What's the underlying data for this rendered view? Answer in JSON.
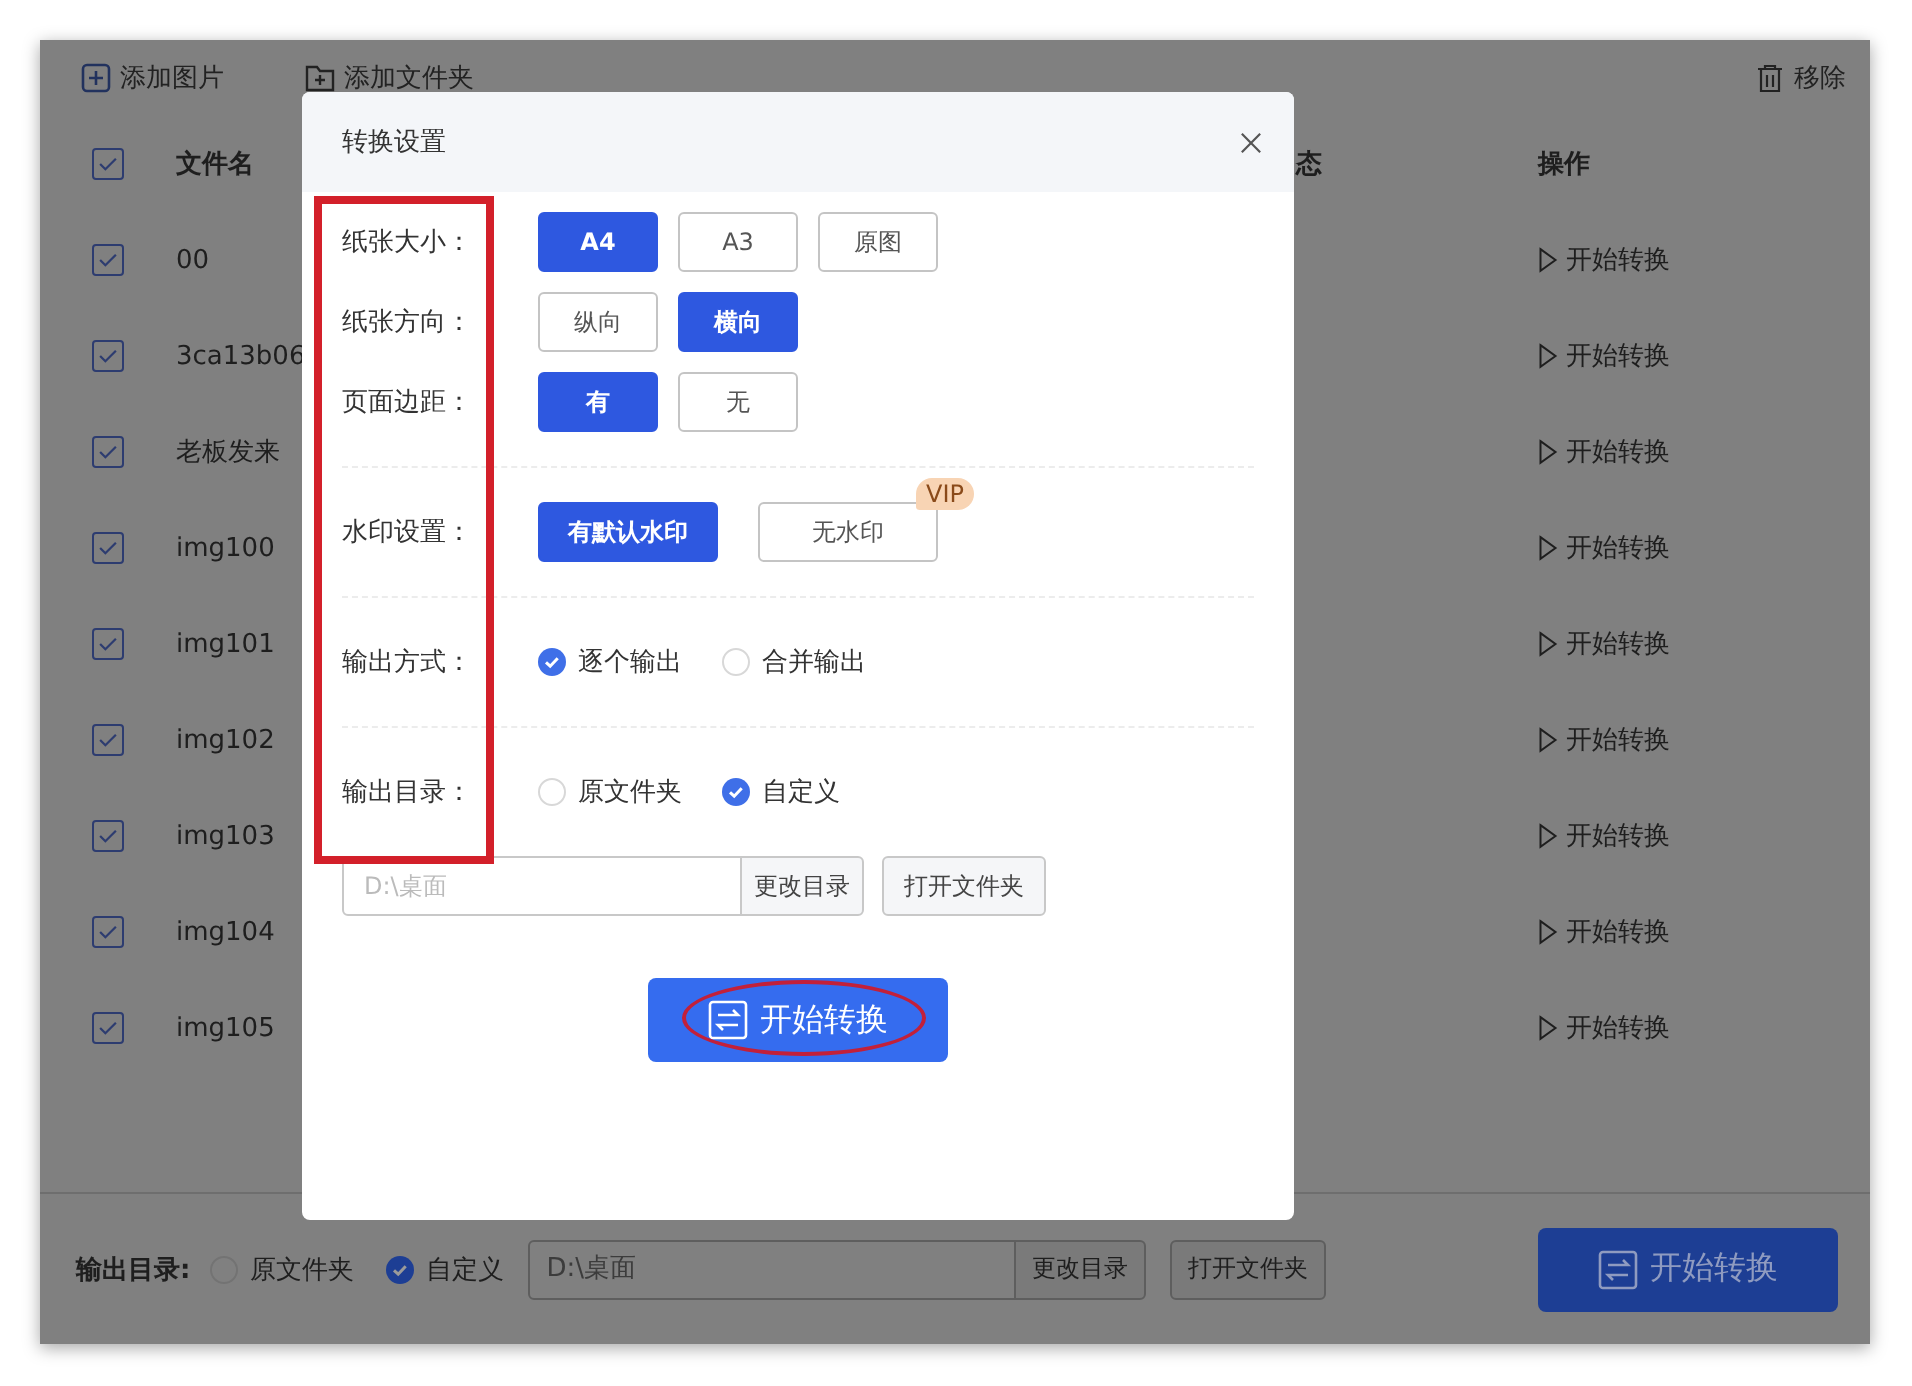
{
  "toolbar": {
    "buttons": [
      {
        "label": "添加图片",
        "kind": "image"
      },
      {
        "label": "添加文件夹",
        "kind": "folder"
      }
    ],
    "remove": "移除"
  },
  "table": {
    "header": {
      "checked": true,
      "columns": [
        "文件名",
        "态",
        "操作"
      ]
    },
    "rows": [
      {
        "checked": true,
        "name": "00",
        "action": "开始转换"
      },
      {
        "checked": true,
        "name": "3ca13b06",
        "action": "开始转换"
      },
      {
        "checked": true,
        "name": "老板发来",
        "action": "开始转换"
      },
      {
        "checked": true,
        "name": "img100",
        "action": "开始转换"
      },
      {
        "checked": true,
        "name": "img101",
        "action": "开始转换"
      },
      {
        "checked": true,
        "name": "img102",
        "action": "开始转换"
      },
      {
        "checked": true,
        "name": "img103",
        "action": "开始转换"
      },
      {
        "checked": true,
        "name": "img104",
        "action": "开始转换"
      },
      {
        "checked": true,
        "name": "img105",
        "action": "开始转换"
      }
    ]
  },
  "bottom_bar": {
    "label": "输出目录:",
    "options": [
      {
        "label": "原文件夹",
        "selected": false
      },
      {
        "label": "自定义",
        "selected": true
      }
    ],
    "path": {
      "placeholder": "D:\\桌面",
      "change_button": "更改目录",
      "open_button": "打开文件夹"
    },
    "start_button": "开始转换"
  },
  "dialog": {
    "title": "转换设置",
    "sections": [
      [
        {
          "label": "纸张大小：",
          "kind": "buttons",
          "options": [
            {
              "label": "A4",
              "selected": true
            },
            {
              "label": "A3",
              "selected": false
            },
            {
              "label": "原图",
              "selected": false
            }
          ]
        },
        {
          "label": "纸张方向：",
          "kind": "buttons",
          "options": [
            {
              "label": "纵向",
              "selected": false
            },
            {
              "label": "横向",
              "selected": true
            }
          ]
        },
        {
          "label": "页面边距：",
          "kind": "buttons",
          "options": [
            {
              "label": "有",
              "selected": true
            },
            {
              "label": "无",
              "selected": false
            }
          ]
        }
      ],
      [
        {
          "label": "水印设置：",
          "kind": "wide-buttons",
          "options": [
            {
              "label": "有默认水印",
              "selected": true
            },
            {
              "label": "无水印",
              "selected": false,
              "badge": "VIP"
            }
          ]
        }
      ],
      [
        {
          "label": "输出方式：",
          "kind": "radios",
          "options": [
            {
              "label": "逐个输出",
              "selected": true
            },
            {
              "label": "合并输出",
              "selected": false
            }
          ]
        }
      ],
      [
        {
          "label": "输出目录：",
          "kind": "radios",
          "options": [
            {
              "label": "原文件夹",
              "selected": false
            },
            {
              "label": "自定义",
              "selected": true
            }
          ]
        }
      ]
    ],
    "path": {
      "placeholder": "D:\\桌面",
      "change_button": "更改目录",
      "open_button": "打开文件夹"
    },
    "start_button": "开始转换"
  }
}
